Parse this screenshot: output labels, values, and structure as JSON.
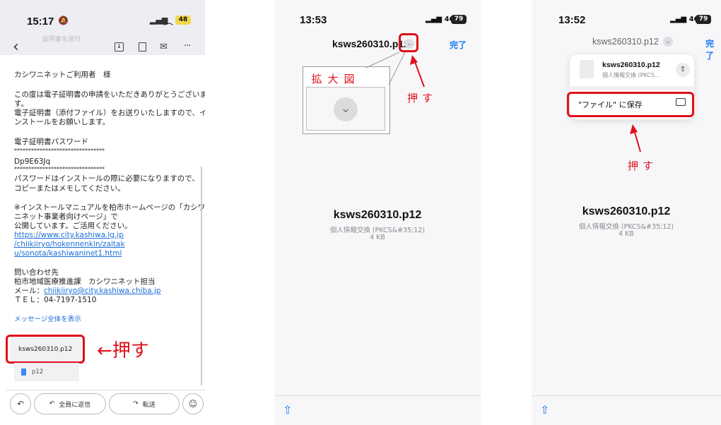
{
  "phone1": {
    "status_time": "15:17",
    "battery": "48",
    "blurred_subject": "証明書を送付",
    "email_lines": [
      "カシワニネットご利用者　様",
      "",
      "この度は電子証明書の申請をいただきありがとうございま",
      "す。",
      "電子証明書（添付ファイル）をお送りいたしますので、イ",
      "ンストールをお願いします。",
      "",
      "電子証明書パスワード",
      "********************************",
      "Dp9E63Jq",
      "********************************",
      "パスワードはインストールの際に必要になりますので、",
      "コピーまたはメモしてください。",
      "",
      "※インストールマニュアルを柏市ホームページの「カシワ",
      "ニネット事業者向けページ」で",
      "公開しています。ご活用ください。"
    ],
    "link_lines": [
      "https://www.city.kashiwa.lg.jp",
      "/chiikiiryo/hokennenkin/zaitak",
      "u/sonota/kashiwaninet1.html"
    ],
    "contact_title": "問い合わせ先",
    "contact_dept": "柏市地域医療推進課　カシワニネット担当",
    "mail_label": "メール：",
    "mail_address": "chiikiiryo@city.kashiwa.chiba.jp",
    "tel": "ＴＥＬ：04-7197-1510",
    "show_all": "メッセージ全体を表示",
    "attachment_name": "ksws260310.p12",
    "attachment_type": "p12",
    "reply_all": "全員に返信",
    "forward": "転送",
    "annotation": "←押す"
  },
  "phone2": {
    "status_time": "13:53",
    "signal": "4G",
    "battery": "79",
    "title": "ksws260310.p12",
    "done": "完了",
    "zoom_label": "拡大図",
    "press_label": "押す",
    "file_name": "ksws260310.p12",
    "file_type": "個人情報交換 (PKCS&#35;12)",
    "file_size": "4 KB"
  },
  "phone3": {
    "status_time": "13:52",
    "signal": "4G",
    "battery": "79",
    "title": "ksws260310.p12",
    "done": "完了",
    "menu_file_name": "ksws260310.p12",
    "menu_file_type": "個人情報交換 (PKCS...",
    "save_to_files": "\"ファイル\" に保存",
    "press_label": "押す",
    "file_name": "ksws260310.p12",
    "file_type": "個人情報交換 (PKCS&#35;12)",
    "file_size": "4 KB"
  }
}
